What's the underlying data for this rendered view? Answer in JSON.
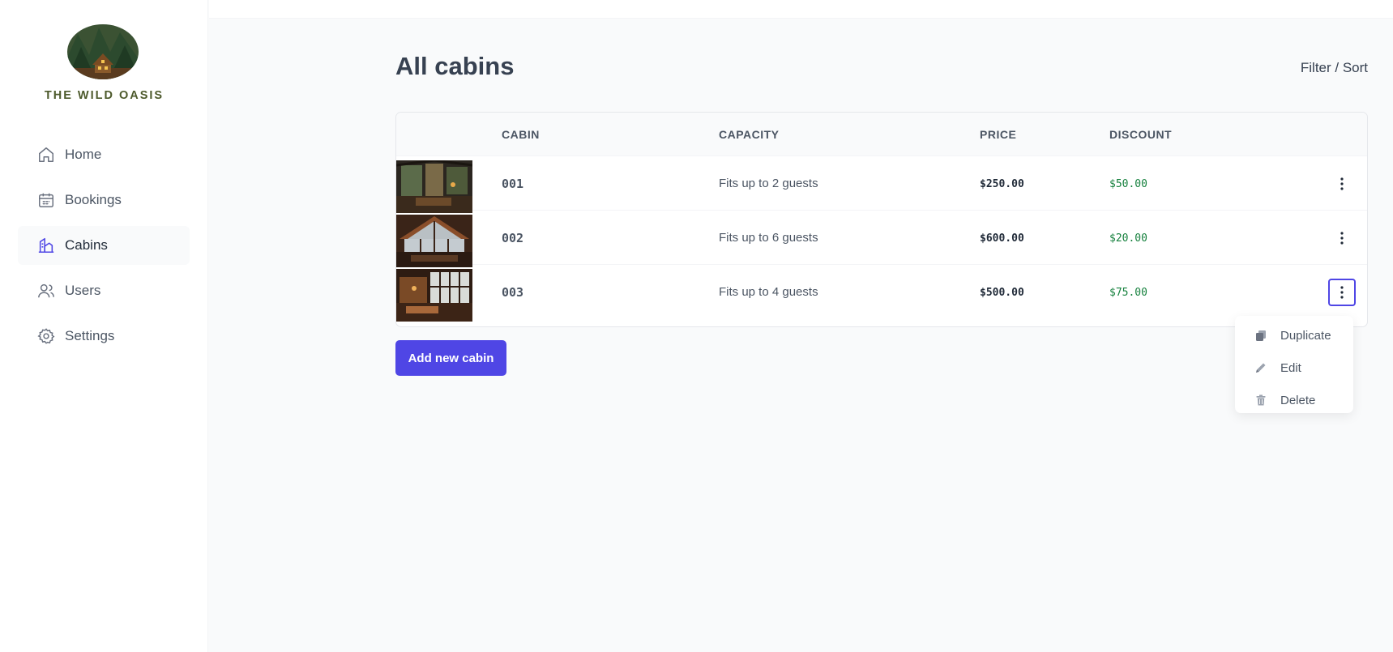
{
  "brand": {
    "name": "THE WILD OASIS"
  },
  "sidebar": {
    "items": [
      {
        "label": "Home",
        "icon": "home-icon",
        "active": false
      },
      {
        "label": "Bookings",
        "icon": "calendar-icon",
        "active": false
      },
      {
        "label": "Cabins",
        "icon": "cabin-icon",
        "active": true
      },
      {
        "label": "Users",
        "icon": "users-icon",
        "active": false
      },
      {
        "label": "Settings",
        "icon": "gear-icon",
        "active": false
      }
    ]
  },
  "main": {
    "title": "All cabins",
    "filter_sort": "Filter / Sort",
    "table": {
      "headers": [
        "",
        "CABIN",
        "CAPACITY",
        "PRICE",
        "DISCOUNT",
        ""
      ],
      "rows": [
        {
          "cabin": "001",
          "capacity": "Fits up to 2 guests",
          "price": "$250.00",
          "discount": "$50.00"
        },
        {
          "cabin": "002",
          "capacity": "Fits up to 6 guests",
          "price": "$600.00",
          "discount": "$20.00"
        },
        {
          "cabin": "003",
          "capacity": "Fits up to 4 guests",
          "price": "$500.00",
          "discount": "$75.00"
        }
      ]
    },
    "add_button": "Add new cabin",
    "menu": {
      "open_row": 3,
      "items": [
        {
          "label": "Duplicate",
          "icon": "duplicate-icon"
        },
        {
          "label": "Edit",
          "icon": "pencil-icon"
        },
        {
          "label": "Delete",
          "icon": "trash-icon"
        }
      ]
    }
  },
  "colors": {
    "accent": "#4f46e5",
    "discount": "#15803d",
    "brand_text": "#4d5a2c"
  }
}
